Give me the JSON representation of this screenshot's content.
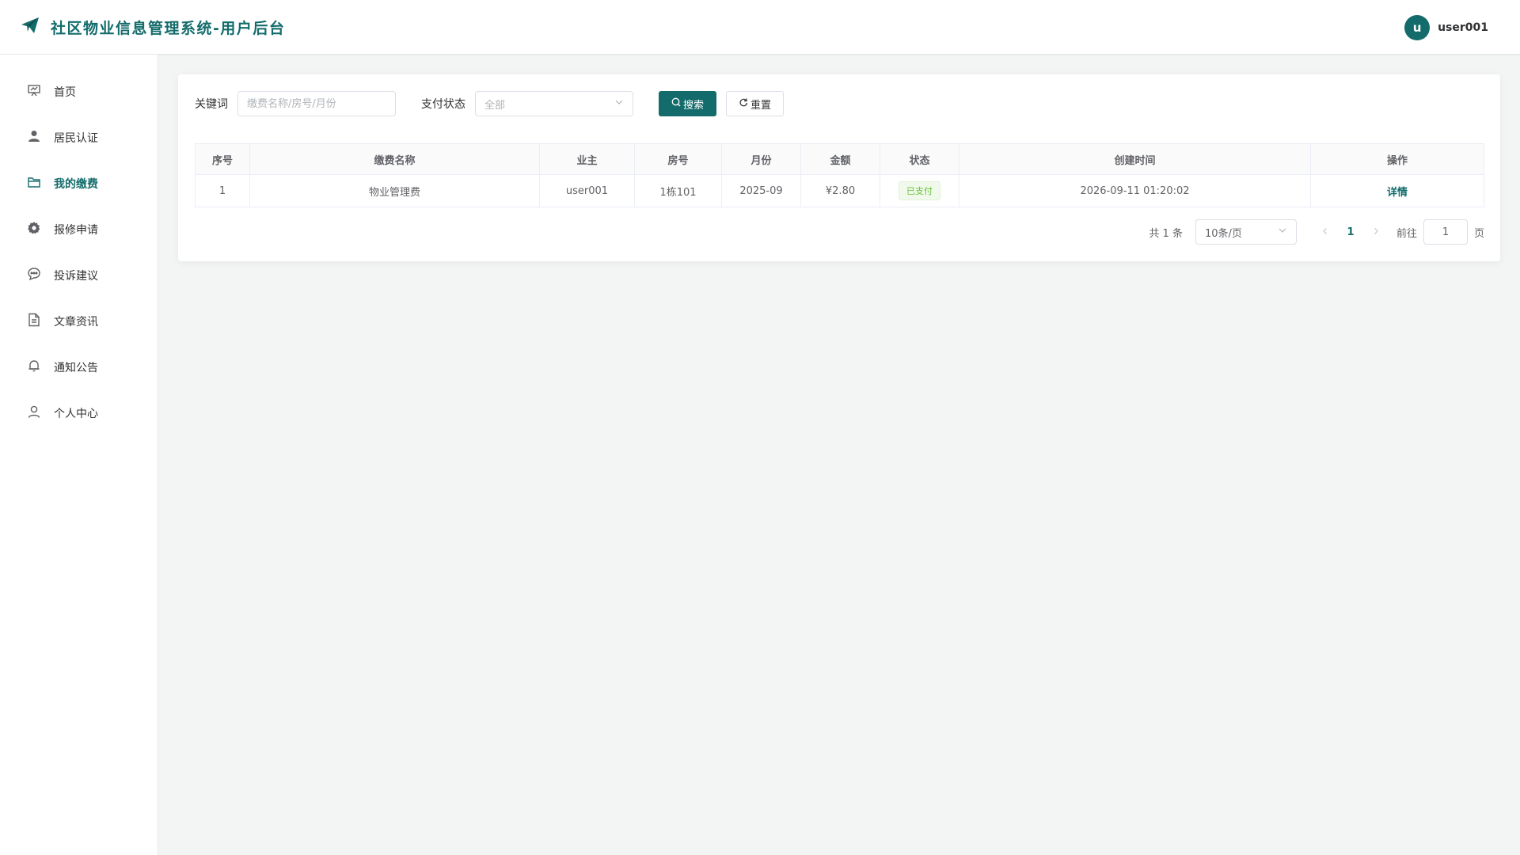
{
  "app": {
    "title": "社区物业信息管理系统-用户后台"
  },
  "user": {
    "avatar_letter": "u",
    "name": "user001"
  },
  "sidebar": {
    "items": [
      {
        "label": "首页",
        "icon": "home-icon"
      },
      {
        "label": "居民认证",
        "icon": "user-filled-icon"
      },
      {
        "label": "我的缴费",
        "icon": "folder-icon",
        "active": true
      },
      {
        "label": "报修申请",
        "icon": "gear-icon"
      },
      {
        "label": "投诉建议",
        "icon": "chat-icon"
      },
      {
        "label": "文章资讯",
        "icon": "document-icon"
      },
      {
        "label": "通知公告",
        "icon": "bell-icon"
      },
      {
        "label": "个人中心",
        "icon": "user-icon"
      }
    ]
  },
  "filters": {
    "keyword_label": "关键词",
    "keyword_value": "",
    "keyword_placeholder": "缴费名称/房号/月份",
    "status_label": "支付状态",
    "status_value": "全部",
    "search_label": "搜索",
    "reset_label": "重置"
  },
  "table": {
    "columns": [
      "序号",
      "缴费名称",
      "业主",
      "房号",
      "月份",
      "金额",
      "状态",
      "创建时间",
      "操作"
    ],
    "rows": [
      {
        "index": "1",
        "name": "物业管理费",
        "owner": "user001",
        "room": "1栋101",
        "month": "2025-09",
        "amount": "¥2.80",
        "status": "已支付",
        "created": "2026-09-11 01:20:02",
        "action": "详情"
      }
    ]
  },
  "pagination": {
    "total_text": "共 1 条",
    "page_size": "10条/页",
    "current_page": "1",
    "goto_label": "前往",
    "goto_value": "1",
    "page_suffix": "页"
  },
  "colors": {
    "accent": "#136c6b",
    "paid_tag": "#67c23a"
  }
}
